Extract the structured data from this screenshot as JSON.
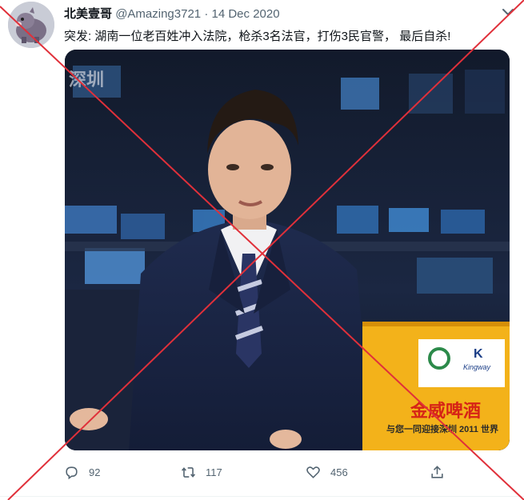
{
  "tweet": {
    "display_name": "北美壹哥",
    "handle": "@Amazing3721",
    "separator": "·",
    "date": "14 Dec 2020",
    "text": "突发: 湖南一位老百姓冲入法院，枪杀3名法官，打伤3民官警， 最后自杀!"
  },
  "media": {
    "watermark": "深圳",
    "sign_line1": "金威啤酒",
    "sign_line2": "与您一同迎接深圳 2011 世界",
    "sign_logo_letter": "K",
    "sign_logo_word": "Kingway"
  },
  "actions": {
    "reply_count": "92",
    "retweet_count": "117",
    "like_count": "456"
  },
  "icons": {
    "reply": "reply-icon",
    "retweet": "retweet-icon",
    "like": "like-icon",
    "share": "share-icon",
    "more": "more-caret-icon"
  },
  "overlay": {
    "cross_color": "#e0303a"
  }
}
